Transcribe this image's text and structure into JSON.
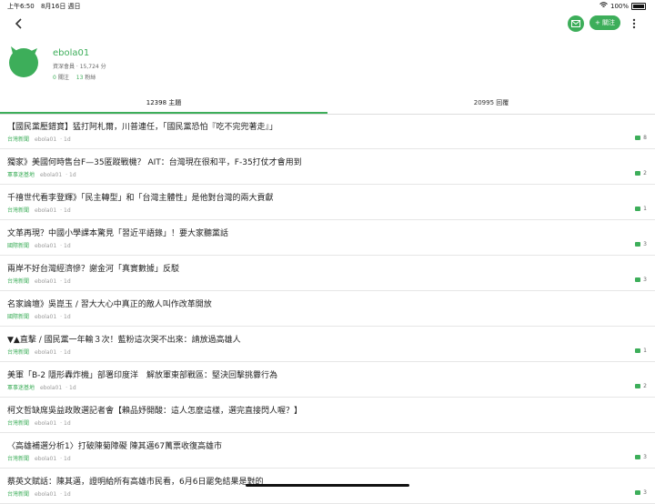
{
  "status_bar": {
    "time": "上午6:50",
    "date": "8月16日 週日",
    "battery": "100%"
  },
  "nav": {
    "back_icon": "chevron-left-icon",
    "mail_icon": "mail-icon",
    "follow_label": "+ 關注",
    "more_icon": "more-vert-icon"
  },
  "profile": {
    "username": "ebola01",
    "level": "資深會員 · 15,724 分",
    "following_count": "0",
    "following_label": "關注",
    "followers_count": "13",
    "followers_label": "粉絲"
  },
  "tabs": [
    {
      "label": "12398 主題"
    },
    {
      "label": "20995 回覆"
    }
  ],
  "posts": [
    {
      "title": "【國民黨壓錯寶】猛打阿札爾，川普連任，「國民黨恐怕『吃不完兜著走』」",
      "forum": "台灣新聞",
      "author": "ebola01",
      "time": "1d",
      "replies": "8"
    },
    {
      "title": "獨家》美國何時售台F—35匿蹤戰機？ AIT：台灣現在很和平，F-35打仗才會用到",
      "forum": "軍事迷基地",
      "author": "ebola01",
      "time": "1d",
      "replies": "2"
    },
    {
      "title": "千禧世代看李登輝》「民主轉型」和「台灣主體性」是他對台灣的兩大貢獻",
      "forum": "台灣新聞",
      "author": "ebola01",
      "time": "1d",
      "replies": "1"
    },
    {
      "title": "文革再現？中國小學課本驚見「習近平語錄」！要大家聽黨話",
      "forum": "國際新聞",
      "author": "ebola01",
      "time": "1d",
      "replies": "3"
    },
    {
      "title": "兩岸不好台灣經濟慘？謝金河「真實數據」反駁",
      "forum": "台灣新聞",
      "author": "ebola01",
      "time": "1d",
      "replies": "3"
    },
    {
      "title": "名家論壇》吳崑玉 / 習大大心中真正的敵人叫作改革開放",
      "forum": "國際新聞",
      "author": "ebola01",
      "time": "1d",
      "replies": ""
    },
    {
      "title": "▼▲直擊 / 國民黨一年輸３次！藍粉這次哭不出來：請放過高雄人",
      "forum": "台灣新聞",
      "author": "ebola01",
      "time": "1d",
      "replies": "1"
    },
    {
      "title": "美軍「B-2 隱形轟炸機」部署印度洋　解放軍東部戰區：堅決回擊挑釁行為",
      "forum": "軍事迷基地",
      "author": "ebola01",
      "time": "1d",
      "replies": "2"
    },
    {
      "title": "柯文哲缺席吳益政敗選記者會【賴品妤開酸：這人怎麼這樣，選完直接閃人喔？】",
      "forum": "台灣新聞",
      "author": "ebola01",
      "time": "1d",
      "replies": ""
    },
    {
      "title": "〈高雄補選分析1〉打破陳菊障礙 陳其邁67萬票收復高雄市",
      "forum": "台灣新聞",
      "author": "ebola01",
      "time": "1d",
      "replies": "3"
    },
    {
      "title": "蔡英文賦話：陳其邁，證明給所有高雄市民看，6月6日罷免結果是對的",
      "forum": "台灣新聞",
      "author": "ebola01",
      "time": "1d",
      "replies": "3"
    }
  ],
  "colors": {
    "accent": "#3dae5a",
    "divider": "#e6e6e6"
  }
}
